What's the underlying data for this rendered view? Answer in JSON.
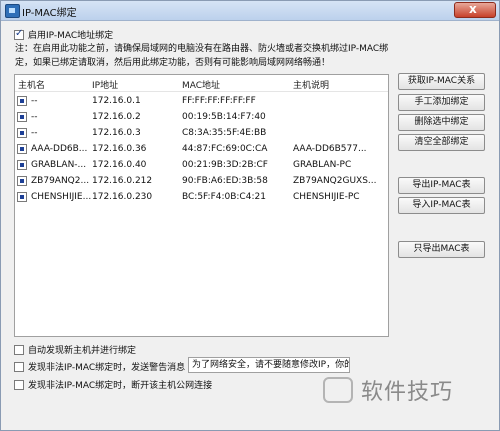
{
  "window": {
    "title": "IP-MAC绑定",
    "close_label": "x"
  },
  "enable_binding": {
    "label": "启用IP-MAC地址绑定",
    "checked": true
  },
  "notice": {
    "line1": "注：在启用此功能之前，请确保局域网的电脑没有在路由器、防火墙或者交换机绑过IP-MAC绑",
    "line2": "定，如果已绑定请取消，然后用此绑定功能，否则有可能影响局域网网络畅通！"
  },
  "table": {
    "headers": {
      "host": "主机名",
      "ip": "IP地址",
      "mac": "MAC地址",
      "desc": "主机说明"
    },
    "rows": [
      {
        "host": "--",
        "ip": "172.16.0.1",
        "mac": "FF:FF:FF:FF:FF:FF",
        "desc": ""
      },
      {
        "host": "--",
        "ip": "172.16.0.2",
        "mac": "00:19:5B:14:F7:40",
        "desc": ""
      },
      {
        "host": "--",
        "ip": "172.16.0.3",
        "mac": "C8:3A:35:5F:4E:BB",
        "desc": ""
      },
      {
        "host": "AAA-DD6B...",
        "ip": "172.16.0.36",
        "mac": "44:87:FC:69:0C:CA",
        "desc": "AAA-DD6B577..."
      },
      {
        "host": "GRABLAN-...",
        "ip": "172.16.0.40",
        "mac": "00:21:9B:3D:2B:CF",
        "desc": "GRABLAN-PC"
      },
      {
        "host": "ZB79ANQ2...",
        "ip": "172.16.0.212",
        "mac": "90:FB:A6:ED:3B:58",
        "desc": "ZB79ANQ2GUXS..."
      },
      {
        "host": "CHENSHIJIE...",
        "ip": "172.16.0.230",
        "mac": "BC:5F:F4:0B:C4:21",
        "desc": "CHENSHIJIE-PC"
      }
    ]
  },
  "buttons": {
    "get_ipmac": "获取IP-MAC关系",
    "manual_add": "手工添加绑定",
    "delete_selected": "删除选中绑定",
    "clear_all": "清空全部绑定",
    "export_ipmac": "导出IP-MAC表",
    "import_ipmac": "导入IP-MAC表",
    "export_mac_only": "只导出MAC表"
  },
  "options": {
    "auto_bind": {
      "label": "自动发现新主机并进行绑定",
      "checked": false
    },
    "send_msg": {
      "label": "发现非法IP-MAC绑定时，发送警告消息",
      "checked": false
    },
    "message_value": "为了网络安全，请不要随意修改IP，你的",
    "disconnect": {
      "label": "发现非法IP-MAC绑定时，断开该主机公网连接",
      "checked": false
    }
  },
  "watermark": {
    "text": "软件技巧"
  }
}
